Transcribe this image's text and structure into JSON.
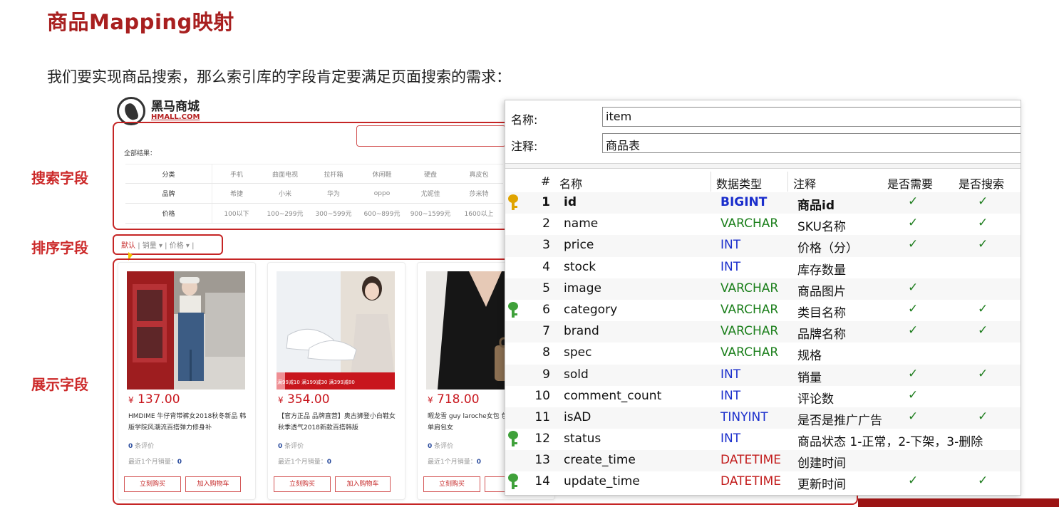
{
  "slide": {
    "title": "商品Mapping映射",
    "intro": "我们要实现商品搜索，那么索引库的字段肯定要满足页面搜索的需求："
  },
  "labels": {
    "search": "搜索字段",
    "sort": "排序字段",
    "display": "展示字段"
  },
  "shop": {
    "logo_cn": "黑马商城",
    "logo_en": "HMALL.COM",
    "all_results": "全部结果：",
    "filters": [
      {
        "name": "分类",
        "values": [
          "手机",
          "曲面电视",
          "拉杆箱",
          "休闲鞋",
          "硬盘",
          "真皮包"
        ]
      },
      {
        "name": "品牌",
        "values": [
          "希捷",
          "小米",
          "华为",
          "oppo",
          "尤妮佳",
          "莎米特"
        ]
      },
      {
        "name": "价格",
        "values": [
          "100以下",
          "100~299元",
          "300~599元",
          "600~899元",
          "900~1599元",
          "1600以上"
        ]
      }
    ],
    "sort": {
      "default": "默认",
      "sales": "销量",
      "price": "价格",
      "sep": "|",
      "arrow": "▾"
    },
    "cards": [
      {
        "currency": "¥",
        "price": "137.00",
        "desc": "HMDIME 牛仔背带裤女2018秋冬新品 韩版学院风潮流百搭弹力修身补",
        "reviews_count": "0",
        "reviews_label": "条评价",
        "sold_label": "最近1个月销量：",
        "sold_count": "0",
        "buy": "立刻购买",
        "cart": "加入购物车"
      },
      {
        "currency": "¥",
        "price": "354.00",
        "desc": "【官方正品 品牌直营】奥古狮登小白鞋女秋季透气2018新款百搭韩版",
        "reviews_count": "0",
        "reviews_label": "条评价",
        "sold_label": "最近1个月销量：",
        "sold_count": "0",
        "buy": "立刻购买",
        "cart": "加入购物车",
        "promo": "满99减10 满199减30 满399减80"
      },
      {
        "currency": "¥",
        "price": "718.00",
        "desc": "暇龙雪 guy laroche女包 包女牛皮大容量单肩包女",
        "reviews_count": "0",
        "reviews_label": "条评价",
        "sold_label": "最近1个月销量：",
        "sold_count": "0",
        "buy": "立刻购买",
        "cart": "加"
      }
    ]
  },
  "table_design": {
    "name_label": "名称:",
    "name_value": "item",
    "comment_label": "注释:",
    "comment_value": "商品表",
    "headers": [
      "#",
      "名称",
      "数据类型",
      "注释",
      "是否需要",
      "是否搜索"
    ],
    "check": "✓",
    "rows": [
      {
        "num": "1",
        "name": "id",
        "type": "BIGINT",
        "comment": "商品id",
        "need": true,
        "search": true,
        "key": "gold",
        "pk": true
      },
      {
        "num": "2",
        "name": "name",
        "type": "VARCHAR",
        "comment": "SKU名称",
        "need": true,
        "search": true,
        "key": ""
      },
      {
        "num": "3",
        "name": "price",
        "type": "INT",
        "comment": "价格（分）",
        "need": true,
        "search": true,
        "key": ""
      },
      {
        "num": "4",
        "name": "stock",
        "type": "INT",
        "comment": "库存数量",
        "need": false,
        "search": false,
        "key": ""
      },
      {
        "num": "5",
        "name": "image",
        "type": "VARCHAR",
        "comment": "商品图片",
        "need": true,
        "search": false,
        "key": ""
      },
      {
        "num": "6",
        "name": "category",
        "type": "VARCHAR",
        "comment": "类目名称",
        "need": true,
        "search": true,
        "key": "green"
      },
      {
        "num": "7",
        "name": "brand",
        "type": "VARCHAR",
        "comment": "品牌名称",
        "need": true,
        "search": true,
        "key": ""
      },
      {
        "num": "8",
        "name": "spec",
        "type": "VARCHAR",
        "comment": "规格",
        "need": false,
        "search": false,
        "key": ""
      },
      {
        "num": "9",
        "name": "sold",
        "type": "INT",
        "comment": "销量",
        "need": true,
        "search": true,
        "key": ""
      },
      {
        "num": "10",
        "name": "comment_count",
        "type": "INT",
        "comment": "评论数",
        "need": true,
        "search": false,
        "key": ""
      },
      {
        "num": "11",
        "name": "isAD",
        "type": "TINYINT",
        "comment": "是否是推广广告",
        "need": true,
        "search": true,
        "key": ""
      },
      {
        "num": "12",
        "name": "status",
        "type": "INT",
        "comment": "商品状态 1-正常，2-下架，3-删除",
        "need": false,
        "search": false,
        "key": "green"
      },
      {
        "num": "13",
        "name": "create_time",
        "type": "DATETIME",
        "comment": "创建时间",
        "need": false,
        "search": false,
        "key": ""
      },
      {
        "num": "14",
        "name": "update_time",
        "type": "DATETIME",
        "comment": "更新时间",
        "need": true,
        "search": true,
        "key": "green"
      }
    ]
  },
  "colors": {
    "accent_red": "#c52525",
    "title_red": "#a81f1f",
    "type_int": "#1a2ecc",
    "type_varchar": "#1b7f1b",
    "type_datetime": "#c21b1b",
    "check_green": "#1e7d1e"
  }
}
